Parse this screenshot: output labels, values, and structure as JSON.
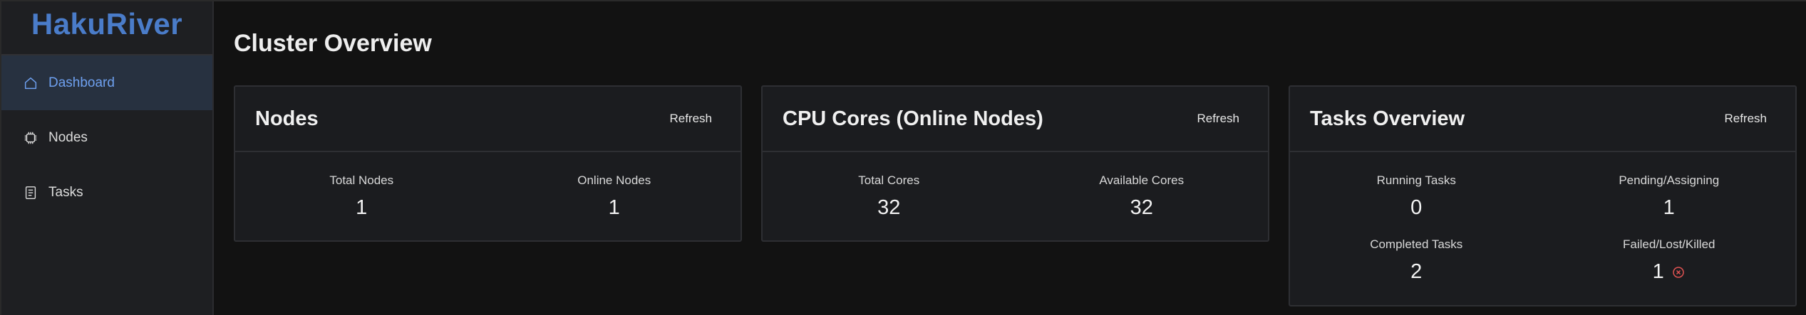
{
  "app": {
    "brand": "HakuRiver"
  },
  "sidebar": {
    "items": [
      {
        "label": "Dashboard",
        "icon": "home-icon",
        "active": true
      },
      {
        "label": "Nodes",
        "icon": "cpu-chip-icon",
        "active": false
      },
      {
        "label": "Tasks",
        "icon": "document-list-icon",
        "active": false
      }
    ]
  },
  "main": {
    "title": "Cluster Overview",
    "cards": [
      {
        "title": "Nodes",
        "refresh_label": "Refresh",
        "stats": [
          {
            "label": "Total Nodes",
            "value": "1"
          },
          {
            "label": "Online Nodes",
            "value": "1"
          }
        ]
      },
      {
        "title": "CPU Cores (Online Nodes)",
        "refresh_label": "Refresh",
        "stats": [
          {
            "label": "Total Cores",
            "value": "32"
          },
          {
            "label": "Available Cores",
            "value": "32"
          }
        ]
      },
      {
        "title": "Tasks Overview",
        "refresh_label": "Refresh",
        "stats": [
          {
            "label": "Running Tasks",
            "value": "0"
          },
          {
            "label": "Pending/Assigning",
            "value": "1"
          },
          {
            "label": "Completed Tasks",
            "value": "2"
          },
          {
            "label": "Failed/Lost/Killed",
            "value": "1",
            "icon": "error-circle-icon"
          }
        ]
      }
    ]
  },
  "colors": {
    "brand": "#4a7cc9",
    "active_nav_bg": "#273140",
    "active_nav_text": "#6ea0ef",
    "error": "#e05252"
  }
}
